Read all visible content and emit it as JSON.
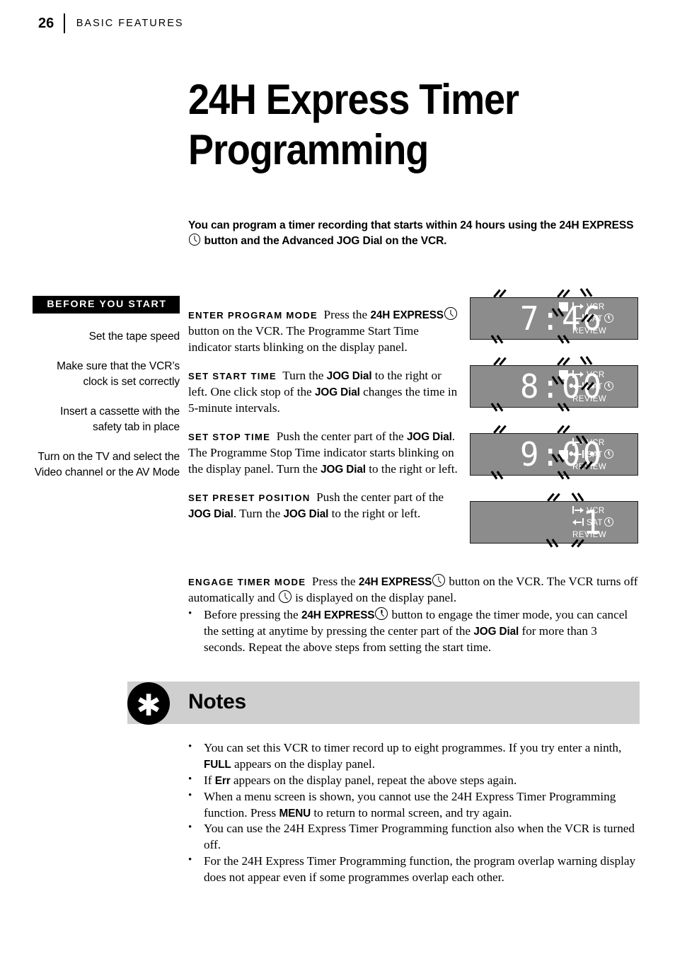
{
  "header": {
    "page_number": "26",
    "section": "BASIC FEATURES"
  },
  "title": {
    "line1": "24H Express Timer",
    "line2": "Programming"
  },
  "intro": {
    "part1": "You can program a timer recording that starts within 24 hours using the 24H EXPRESS",
    "part2": "button and the Advanced JOG Dial on the VCR."
  },
  "sidebar": {
    "heading": "BEFORE YOU START",
    "items": [
      "Set the tape speed",
      "Make sure that the VCR’s clock is set correctly",
      "Insert a cassette with the safety tab in place",
      "Turn on the TV and select the Video channel or the AV Mode"
    ]
  },
  "steps": [
    {
      "label": "ENTER PROGRAM MODE",
      "text_before_icon": "Press the ",
      "bold1": "24H EXPRESS",
      "text_after_icon": "button on the VCR. The Programme Start Time indicator starts blinking on the display panel."
    },
    {
      "label": "SET START TIME",
      "text_a": "Turn the ",
      "bold_a": "JOG Dial",
      "text_b": " to the right or left. One click stop of the ",
      "bold_b": "JOG Dial",
      "text_c": " changes the time in 5-minute intervals."
    },
    {
      "label": "SET STOP TIME",
      "text_a": "Push the center part of the ",
      "bold_a": "JOG Dial",
      "text_b": ". The Programme Stop Time indicator starts blinking on the display panel. Turn the ",
      "bold_b": "JOG Dial",
      "text_c": " to the right or left."
    },
    {
      "label": "SET PRESET POSITION",
      "text_a": "Push the center part of the ",
      "bold_a": "JOG Dial",
      "text_b": ". Turn the ",
      "bold_b": "JOG Dial",
      "text_c": " to the right or left."
    }
  ],
  "engage": {
    "label": "ENGAGE TIMER MODE",
    "t1": "Press the ",
    "b1": "24H EXPRESS",
    "t2": "button on the VCR. The VCR turns off automatically and ",
    "t3": "is displayed on the display panel.",
    "bullet_dot": "•",
    "bt1": "Before pressing the ",
    "bb1": "24H EXPRESS",
    "bt2": "button to engage the timer mode, you can cancel the setting at anytime by pressing the center part of the ",
    "bb2": "JOG Dial",
    "bt3": " for more than 3 seconds. Repeat the above steps from setting the start time."
  },
  "display_panels": [
    {
      "name": "programme-start-time",
      "digits": "7:46",
      "blink_indicator_row": 1,
      "indicator_rows": [
        {
          "arrow": "start-arrow-icon",
          "label": "VCR",
          "clock": true
        },
        {
          "arrow": "stop-arrow-icon",
          "label": "SAT",
          "clock": true
        },
        {
          "arrow": "",
          "label": "REVIEW",
          "clock": false
        }
      ]
    },
    {
      "name": "start-time-set",
      "digits": "8:00",
      "blink_indicator_row": 1,
      "indicator_rows": [
        {
          "arrow": "start-arrow-icon",
          "label": "VCR",
          "clock": true
        },
        {
          "arrow": "stop-arrow-icon",
          "label": "SAT",
          "clock": true
        },
        {
          "arrow": "",
          "label": "REVIEW",
          "clock": false
        }
      ]
    },
    {
      "name": "stop-time-set",
      "digits": "9:00",
      "blink_indicator_row": 2,
      "indicator_rows": [
        {
          "arrow": "start-arrow-icon",
          "label": "VCR",
          "clock": true
        },
        {
          "arrow": "stop-arrow-icon",
          "label": "SAT",
          "clock": true
        },
        {
          "arrow": "",
          "label": "REVIEW",
          "clock": false
        }
      ]
    },
    {
      "name": "preset-position",
      "digits": "1",
      "blink_indicator_row": 0,
      "indicator_rows": [
        {
          "arrow": "start-arrow-icon",
          "label": "VCR",
          "clock": true
        },
        {
          "arrow": "stop-arrow-icon",
          "label": "SAT",
          "clock": true
        },
        {
          "arrow": "",
          "label": "REVIEW",
          "clock": false
        }
      ]
    }
  ],
  "notes": {
    "badge_glyph": "✱",
    "title": "Notes",
    "bullet_dot": "•",
    "items": [
      {
        "t1": "You can set this VCR to timer record up to eight programmes. If you try enter a ninth, ",
        "b1": "FULL",
        "t2": " appears on the display panel."
      },
      {
        "t1": "If ",
        "b1": "Err",
        "t2": " appears on the display panel, repeat the above steps again."
      },
      {
        "t1": "When a menu screen is shown, you cannot use the 24H Express Timer Programming function. Press ",
        "b1": "MENU",
        "t2": " to return to normal screen, and try again."
      },
      {
        "t1": "You can use the 24H Express Timer Programming function also when the VCR is turned off.",
        "b1": "",
        "t2": ""
      },
      {
        "t1": "For the 24H Express Timer Programming function, the program overlap warning display does not appear even if some programmes overlap each other.",
        "b1": "",
        "t2": ""
      }
    ]
  },
  "colors": {
    "panel_bg": "#8c8c8c",
    "panel_border": "#1a1a1a",
    "panel_text": "#ffffff",
    "notes_band": "#cfcfcf",
    "ink": "#000000"
  }
}
